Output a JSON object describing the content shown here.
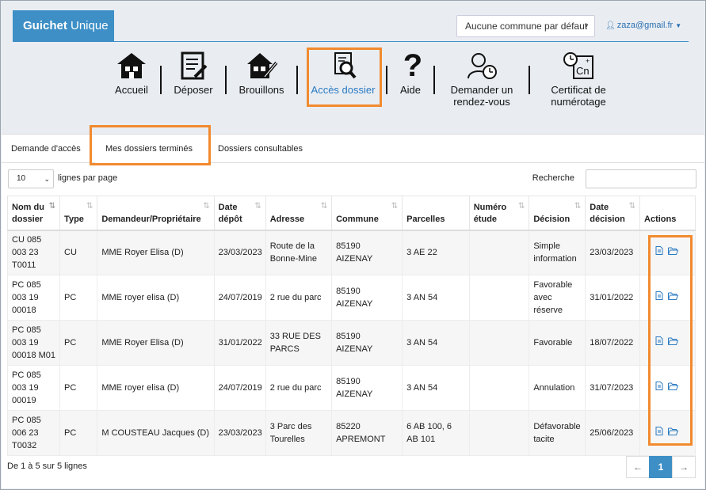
{
  "header": {
    "brand_bold": "Guichet",
    "brand_rest": " Unique",
    "commune_select": "Aucune commune par défaut",
    "user_email": "zaza@gmail.fr"
  },
  "nav": {
    "accueil": "Accueil",
    "deposer": "Déposer",
    "brouillons": "Brouillons",
    "acces_dossier": "Accès dossier",
    "aide": "Aide",
    "rdv_line1": "Demander un",
    "rdv_line2": "rendez-vous",
    "cert_line1": "Certificat de",
    "cert_line2": "numérotage"
  },
  "tabs": {
    "demande": "Demande d'accès",
    "termines": "Mes dossiers terminés",
    "consultables": "Dossiers consultables"
  },
  "controls": {
    "page_length": "10",
    "page_length_label": "lignes par page",
    "search_label": "Recherche"
  },
  "table": {
    "headers": {
      "nom_line1": "Nom du",
      "nom_line2": "dossier",
      "type": "Type",
      "demandeur": "Demandeur/Propriétaire",
      "date_depot_line1": "Date",
      "date_depot_line2": "dépôt",
      "adresse": "Adresse",
      "commune": "Commune",
      "parcelles": "Parcelles",
      "numero_line1": "Numéro",
      "numero_line2": "étude",
      "decision": "Décision",
      "date_decision_line1": "Date",
      "date_decision_line2": "décision",
      "actions": "Actions"
    },
    "rows": [
      {
        "nom": [
          "CU 085",
          "003 23",
          "T0011"
        ],
        "type": "CU",
        "demandeur": "MME Royer Elisa (D)",
        "depot": "23/03/2023",
        "adresse": [
          "Route de la",
          "Bonne-Mine"
        ],
        "commune": [
          "85190",
          "AIZENAY"
        ],
        "parcelles": [
          "3 AE 22"
        ],
        "numero": "",
        "decision": [
          "Simple",
          "information"
        ],
        "date_decision": "23/03/2023"
      },
      {
        "nom": [
          "PC 085",
          "003 19",
          "00018"
        ],
        "type": "PC",
        "demandeur": "MME royer elisa (D)",
        "depot": "24/07/2019",
        "adresse": [
          "2 rue du parc"
        ],
        "commune": [
          "85190",
          "AIZENAY"
        ],
        "parcelles": [
          "3 AN 54"
        ],
        "numero": "",
        "decision": [
          "Favorable",
          "avec",
          "réserve"
        ],
        "date_decision": "31/01/2022"
      },
      {
        "nom": [
          "PC 085",
          "003 19",
          "00018 M01"
        ],
        "type": "PC",
        "demandeur": "MME Royer Elisa (D)",
        "depot": "31/01/2022",
        "adresse": [
          "33 RUE DES",
          "PARCS"
        ],
        "commune": [
          "85190",
          "AIZENAY"
        ],
        "parcelles": [
          "3 AN 54"
        ],
        "numero": "",
        "decision": [
          "Favorable"
        ],
        "date_decision": "18/07/2022"
      },
      {
        "nom": [
          "PC 085",
          "003 19",
          "00019"
        ],
        "type": "PC",
        "demandeur": "MME royer elisa (D)",
        "depot": "24/07/2019",
        "adresse": [
          "2 rue du parc"
        ],
        "commune": [
          "85190",
          "AIZENAY"
        ],
        "parcelles": [
          "3 AN 54"
        ],
        "numero": "",
        "decision": [
          "Annulation"
        ],
        "date_decision": "31/07/2023"
      },
      {
        "nom": [
          "PC 085",
          "006 23",
          "T0032"
        ],
        "type": "PC",
        "demandeur": "M COUSTEAU Jacques (D)",
        "depot": "23/03/2023",
        "adresse": [
          "3 Parc des",
          "Tourelles"
        ],
        "commune": [
          "85220",
          "APREMONT"
        ],
        "parcelles": [
          "6 AB 100, 6",
          "AB 101"
        ],
        "numero": "",
        "decision": [
          "Défavorable",
          "tacite"
        ],
        "date_decision": "25/06/2023"
      }
    ]
  },
  "footer": {
    "info": "De 1 à 5 sur 5 lignes",
    "prev": "←",
    "page": "1",
    "next": "→"
  },
  "colors": {
    "brand": "#3d8fc6",
    "highlight": "#f28a2e",
    "link": "#2a7ac0"
  }
}
